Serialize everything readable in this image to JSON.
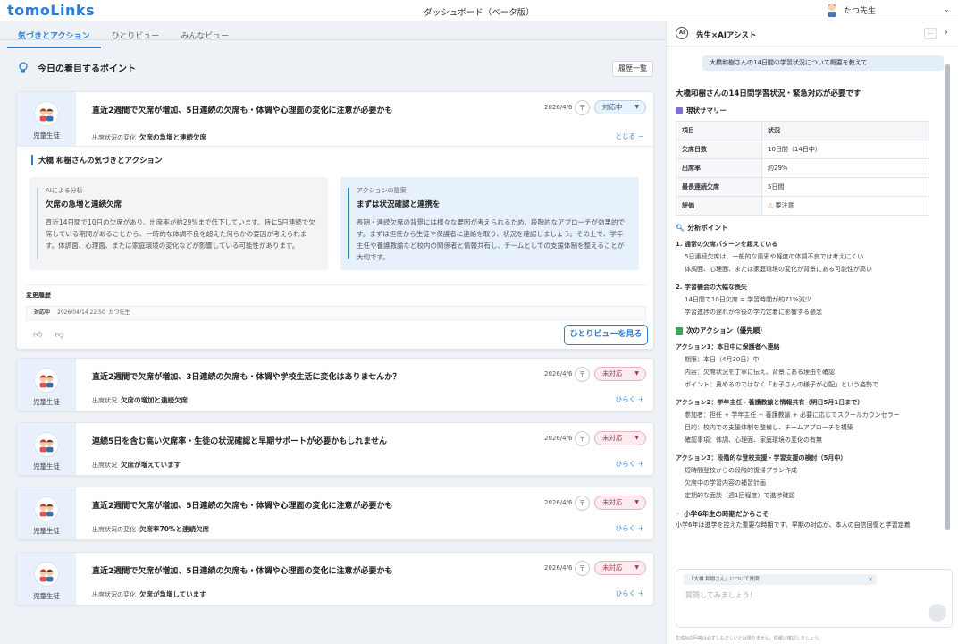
{
  "app": {
    "logo": "tomoLinks",
    "title": "ダッシュボード（ベータ版）",
    "user": "たつ先生"
  },
  "tabs": [
    {
      "label": "気づきとアクション",
      "active": true
    },
    {
      "label": "ひとりビュー"
    },
    {
      "label": "みんなビュー"
    }
  ],
  "section": {
    "title": "今日の着目するポイント",
    "history_button": "履歴一覧"
  },
  "student_label": "児童生徒",
  "cards": [
    {
      "title": "直近2週間で欠席が増加、5日連続の欠席も・体調や心理面の変化に注意が必要かも",
      "date": "2026/4/6",
      "pin": "〒",
      "status": "対応中",
      "reason_label": "出席状況の変化",
      "reason": "欠席の急増と連続欠席",
      "toggle": "とじる －"
    },
    {
      "title": "直近2週間で欠席が増加、3日連続の欠席も・体調や学校生活に変化はありませんか？",
      "date": "2026/4/6",
      "pin": "〒",
      "status": "未対応",
      "reason_label": "出席状況",
      "reason": "欠席の増加と連続欠席",
      "toggle": "ひらく ＋"
    },
    {
      "title": "連続5日を含む高い欠席率・生徒の状況確認と早期サポートが必要かもしれません",
      "date": "2026/4/6",
      "pin": "〒",
      "status": "未対応",
      "reason_label": "出席状況",
      "reason": "欠席が増えています",
      "toggle": "ひらく ＋"
    },
    {
      "title": "直近2週間で欠席が増加、5日連続の欠席も・体調や心理面の変化に注意が必要かも",
      "date": "2026/4/6",
      "pin": "〒",
      "status": "未対応",
      "reason_label": "出席状況の変化",
      "reason": "欠席率70%と連続欠席",
      "toggle": "ひらく ＋"
    },
    {
      "title": "直近2週間で欠席が増加、5日連続の欠席も・体調や心理面の変化に注意が必要かも",
      "date": "2026/4/6",
      "pin": "〒",
      "status": "未対応",
      "reason_label": "出席状況の変化",
      "reason": "欠席が急増しています",
      "toggle": "ひらく ＋"
    }
  ],
  "detail": {
    "heading": "大橋 和樹さんの気づきとアクション",
    "analysis": {
      "label": "AIによる分析",
      "title": "欠席の急増と連続欠席",
      "body": "直近14日間で10日の欠席があり、出席率が約29%まで低下しています。特に5日連続で欠席している期間があることから、一時的な体調不良を超えた何らかの要因が考えられます。体調面、心理面、または家庭環境の変化などが影響している可能性があります。"
    },
    "action": {
      "label": "アクションの提案",
      "title": "まずは状況確認と連携を",
      "body": "長期・連続欠席の背景には様々な要因が考えられるため、段階的なアプローチが効果的です。まずは担任から生徒や保護者に連絡を取り、状況を確認しましょう。その上で、学年主任や養護教諭など校内の関係者と情報共有し、チームとしての支援体制を整えることが大切です。"
    },
    "history_label": "変更履歴",
    "history_status": "対応中",
    "history_date": "2026/04/14 22:50",
    "history_user": "たつ先生",
    "view_button": "ひとりビューを見る"
  },
  "assistant": {
    "title": "先生×AIアシスト",
    "ai_badge": "AI",
    "more": "...",
    "close": "›",
    "user_message": "大橋和樹さんの14日間の学習状況について概要を教えて",
    "heading": "大橋和樹さんの14日間学習状況・緊急対応が必要です",
    "summary_title": "現状サマリー",
    "table": [
      [
        "項目",
        "状況"
      ],
      [
        "欠席日数",
        "10日間（14日中）"
      ],
      [
        "出席率",
        "約29%"
      ],
      [
        "最長連続欠席",
        "5日間"
      ],
      [
        "評価",
        "要注意"
      ]
    ],
    "analysis_title": "分析ポイント",
    "p1_title": "1. 通常の欠席パターンを超えている",
    "p1_l1": "5日連続欠席は、一般的な風邪や軽度の体調不良では考えにくい",
    "p1_l2": "体調面、心理面、または家庭環境の変化が背景にある可能性が高い",
    "p2_title": "2. 学習機会の大幅な喪失",
    "p2_l1": "14日間で10日欠席 = 学習時間が約71%減少",
    "p2_l2": "学習進捗の遅れが今後の学力定着に影響する懸念",
    "next_title": "次のアクション（優先順）",
    "a1_title": "アクション1：本日中に保護者へ連絡",
    "a1_l1": "期限：本日（4月30日）中",
    "a1_l2": "内容：欠席状況を丁寧に伝え、背景にある理由を確認",
    "a1_l3": "ポイント：責めるのではなく「お子さんの様子が心配」という姿勢で",
    "a2_title": "アクション2：学年主任・養護教諭と情報共有（明日5月1日まで）",
    "a2_l1": "参加者：担任 + 学年主任 + 養護教諭 + 必要に応じてスクールカウンセラー",
    "a2_l2": "目的：校内での支援体制を整備し、チームアプローチを構築",
    "a2_l3": "確認事項：体調、心理面、家庭環境の変化の有無",
    "a3_title": "アクション3：段階的な登校支援・学習支援の検討（5月中）",
    "a3_l1": "短時間登校からの段階的復帰プラン作成",
    "a3_l2": "欠席中の学習内容の補習計画",
    "a3_l3": "定期的な面談（週1回程度）で進捗確認",
    "tip_title": "小学6年生の時期だからこそ",
    "tip_body": "小学6年は進学を控えた重要な時期です。早期の対応が、本人の自信回復と学習定着",
    "context_tag": "「大橋 和樹さん」について質問",
    "context_close": "×",
    "placeholder": "質問してみましょう！",
    "footer": "生成AIの回答は必ずしも正しいとは限りません。情報は確認しましょう。"
  },
  "colors": {
    "accent": "#2f7fd6",
    "student_bg": "#e8f1fb",
    "status_active": "#eaf2fb",
    "status_todo": "#fdecef"
  }
}
